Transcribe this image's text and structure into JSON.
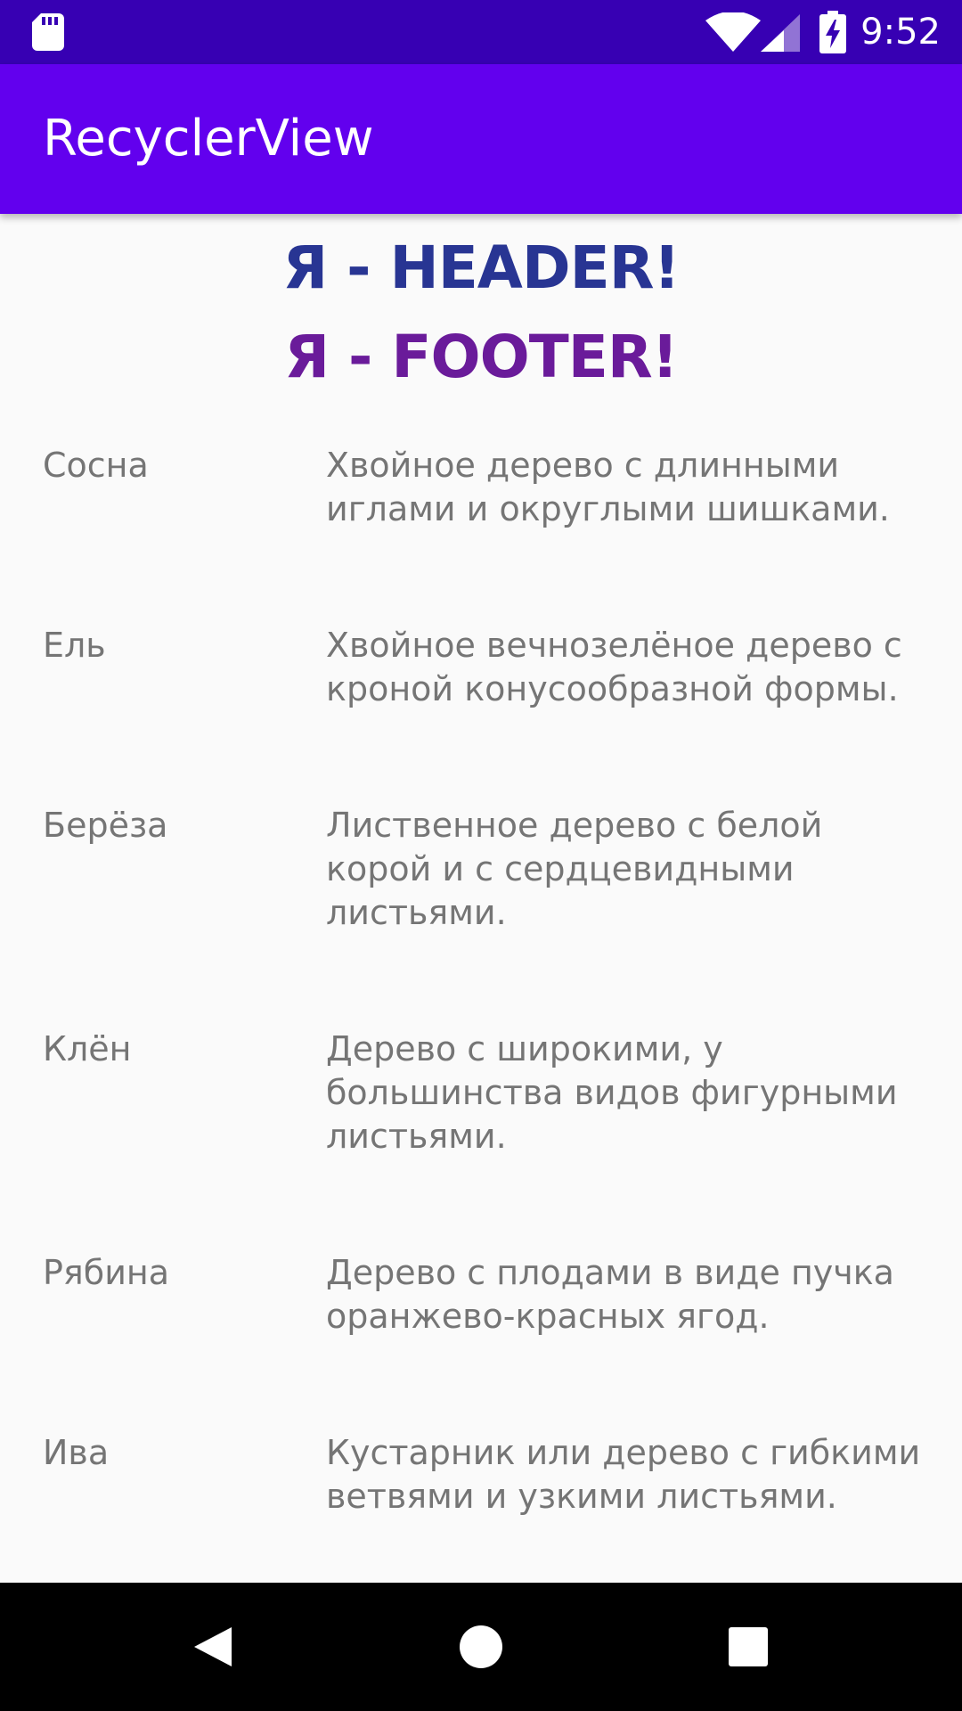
{
  "status_bar": {
    "time": "9:52",
    "icons": [
      "sd-card-icon",
      "wifi-icon",
      "cell-signal-icon",
      "battery-charging-icon"
    ]
  },
  "app_bar": {
    "title": "RecyclerView"
  },
  "list": {
    "header_text": "Я - HEADER!",
    "footer_text": "Я - FOOTER!",
    "items": [
      {
        "name": "Сосна",
        "lines": [
          "Хвойное дерево с длинными",
          "иглами и округлыми шишками."
        ]
      },
      {
        "name": "Ель",
        "lines": [
          "Хвойное вечнозелёное дерево с",
          "кроной конусообразной формы."
        ]
      },
      {
        "name": "Берёза",
        "lines": [
          "Лиственное дерево с белой",
          "корой и с сердцевидными",
          "листьями."
        ]
      },
      {
        "name": "Клён",
        "lines": [
          "Дерево с широкими, у",
          "большинства видов фигурными",
          "листьями."
        ]
      },
      {
        "name": "Рябина",
        "lines": [
          "Дерево с плодами в виде пучка",
          "оранжево-красных ягод."
        ]
      },
      {
        "name": "Ива",
        "lines": [
          "Кустарник или дерево с гибкими",
          "ветвями и узкими листьями."
        ]
      }
    ]
  },
  "nav_bar": {
    "buttons": [
      "back-icon",
      "home-icon",
      "recents-icon"
    ]
  },
  "colors": {
    "status_bar": "#3700b3",
    "app_bar": "#6200ee",
    "header_text": "#283593",
    "footer_text": "#6a1b9a",
    "item_text": "#757575",
    "background": "#fafafa",
    "nav_bar": "#000000"
  }
}
